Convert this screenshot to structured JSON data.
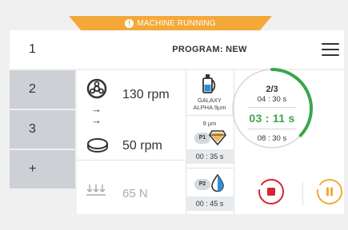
{
  "status_banner": {
    "text": "MACHINE RUNNING",
    "icon": "warning-icon",
    "color": "#f3a93a"
  },
  "sidebar": {
    "items": [
      {
        "label": "1",
        "state": "active"
      },
      {
        "label": "2",
        "state": "inactive"
      },
      {
        "label": "3",
        "state": "inactive"
      },
      {
        "label": "+",
        "state": "inactive"
      }
    ]
  },
  "header": {
    "title": "PROGRAM: NEW",
    "menu_icon": "hamburger-menu-icon"
  },
  "step2": {
    "speed": "130 rpm",
    "head_icon": "head-disc-icon",
    "arrow_1": "→",
    "arrow_2": "→"
  },
  "step3": {
    "speed": "50 rpm",
    "platen_icon": "platen-icon"
  },
  "load": {
    "value": "65 N",
    "icon": "force-arrows-icon"
  },
  "abrasive": {
    "name_line1": "GALAXY",
    "name_line2": "ALPHA 9µm",
    "grain": "9 µm",
    "p1_label": "P1",
    "p1_time": "00 : 35 s",
    "icon": "diamond-icon"
  },
  "lubricant": {
    "p2_label": "P2",
    "p2_time": "00 : 45 s",
    "icon": "droplet-icon"
  },
  "progress": {
    "step": "2/3",
    "step_time": "04 : 30 s",
    "elapsed": "03 : 11 s",
    "total": "08 : 30 s",
    "fraction": 0.37,
    "color": "#3aa64a"
  },
  "controls": {
    "stop_color": "#d7262f",
    "pause_color": "#f3a93a"
  }
}
